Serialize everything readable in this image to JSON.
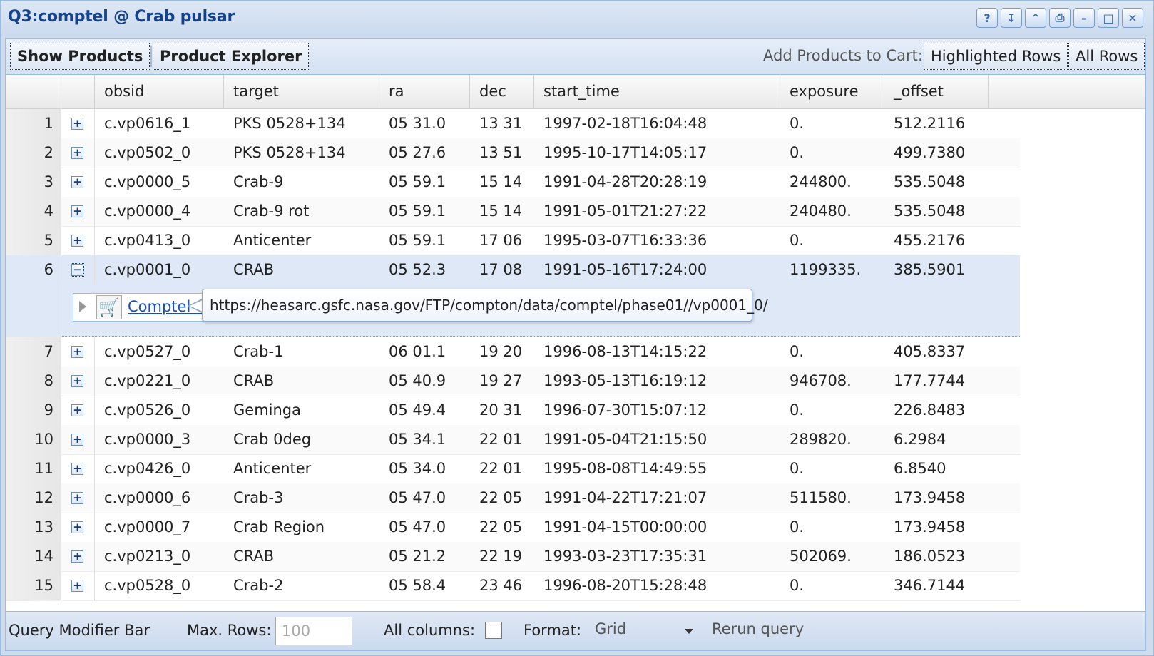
{
  "window": {
    "title": "Q3:comptel @ Crab pulsar"
  },
  "tools": [
    "help-icon",
    "pin-icon",
    "collapse-icon",
    "print-icon",
    "minimize-icon",
    "maximize-icon",
    "close-icon"
  ],
  "toolbar": {
    "show_products": "Show Products",
    "product_explorer": "Product Explorer",
    "add_label": "Add Products to Cart:",
    "highlighted_rows": "Highlighted Rows",
    "all_rows": "All Rows"
  },
  "columns": [
    "obsid",
    "target",
    "ra",
    "dec",
    "start_time",
    "exposure",
    "_offset"
  ],
  "rows": [
    {
      "n": "1",
      "obsid": "c.vp0616_1",
      "target": "PKS 0528+134",
      "ra": "05 31.0",
      "dec": "13 31",
      "start_time": "1997-02-18T16:04:48",
      "exposure": "0.",
      "offset": "512.2116"
    },
    {
      "n": "2",
      "obsid": "c.vp0502_0",
      "target": "PKS 0528+134",
      "ra": "05 27.6",
      "dec": "13 51",
      "start_time": "1995-10-17T14:05:17",
      "exposure": "0.",
      "offset": "499.7380"
    },
    {
      "n": "3",
      "obsid": "c.vp0000_5",
      "target": "Crab-9",
      "ra": "05 59.1",
      "dec": "15 14",
      "start_time": "1991-04-28T20:28:19",
      "exposure": "244800.",
      "offset": "535.5048"
    },
    {
      "n": "4",
      "obsid": "c.vp0000_4",
      "target": "Crab-9 rot",
      "ra": "05 59.1",
      "dec": "15 14",
      "start_time": "1991-05-01T21:27:22",
      "exposure": "240480.",
      "offset": "535.5048"
    },
    {
      "n": "5",
      "obsid": "c.vp0413_0",
      "target": "Anticenter",
      "ra": "05 59.1",
      "dec": "17 06",
      "start_time": "1995-03-07T16:33:36",
      "exposure": "0.",
      "offset": "455.2176"
    },
    {
      "n": "6",
      "obsid": "c.vp0001_0",
      "target": "CRAB",
      "ra": "05 52.3",
      "dec": "17 08",
      "start_time": "1991-05-16T17:24:00",
      "exposure": "1199335.",
      "offset": "385.5901"
    },
    {
      "n": "7",
      "obsid": "c.vp0527_0",
      "target": "Crab-1",
      "ra": "06 01.1",
      "dec": "19 20",
      "start_time": "1996-08-13T14:15:22",
      "exposure": "0.",
      "offset": "405.8337"
    },
    {
      "n": "8",
      "obsid": "c.vp0221_0",
      "target": "CRAB",
      "ra": "05 40.9",
      "dec": "19 27",
      "start_time": "1993-05-13T16:19:12",
      "exposure": "946708.",
      "offset": "177.7744"
    },
    {
      "n": "9",
      "obsid": "c.vp0526_0",
      "target": "Geminga",
      "ra": "05 49.4",
      "dec": "20 31",
      "start_time": "1996-07-30T15:07:12",
      "exposure": "0.",
      "offset": "226.8483"
    },
    {
      "n": "10",
      "obsid": "c.vp0000_3",
      "target": "Crab 0deg",
      "ra": "05 34.1",
      "dec": "22 01",
      "start_time": "1991-05-04T21:15:50",
      "exposure": "289820.",
      "offset": "6.2984"
    },
    {
      "n": "11",
      "obsid": "c.vp0426_0",
      "target": "Anticenter",
      "ra": "05 34.0",
      "dec": "22 01",
      "start_time": "1995-08-08T14:49:55",
      "exposure": "0.",
      "offset": "6.8540"
    },
    {
      "n": "12",
      "obsid": "c.vp0000_6",
      "target": "Crab-3",
      "ra": "05 47.0",
      "dec": "22 05",
      "start_time": "1991-04-22T17:21:07",
      "exposure": "511580.",
      "offset": "173.9458"
    },
    {
      "n": "13",
      "obsid": "c.vp0000_7",
      "target": "Crab Region",
      "ra": "05 47.0",
      "dec": "22 05",
      "start_time": "1991-04-15T00:00:00",
      "exposure": "0.",
      "offset": "173.9458"
    },
    {
      "n": "14",
      "obsid": "c.vp0213_0",
      "target": "CRAB",
      "ra": "05 21.2",
      "dec": "22 19",
      "start_time": "1993-03-23T17:35:31",
      "exposure": "502069.",
      "offset": "186.0523"
    },
    {
      "n": "15",
      "obsid": "c.vp0528_0",
      "target": "Crab-2",
      "ra": "05 58.4",
      "dec": "23 46",
      "start_time": "1996-08-20T15:28:48",
      "exposure": "0.",
      "offset": "346.7144"
    }
  ],
  "expanded": {
    "product_link": "Comptel O",
    "tooltip": "https://heasarc.gsfc.nasa.gov/FTP/compton/data/comptel/phase01//vp0001_0/"
  },
  "query_bar": {
    "title": "Query Modifier Bar",
    "max_rows_label": "Max. Rows:",
    "max_rows_placeholder": "100",
    "all_columns_label": "All columns:",
    "format_label": "Format:",
    "format_value": "Grid",
    "rerun": "Rerun query"
  }
}
